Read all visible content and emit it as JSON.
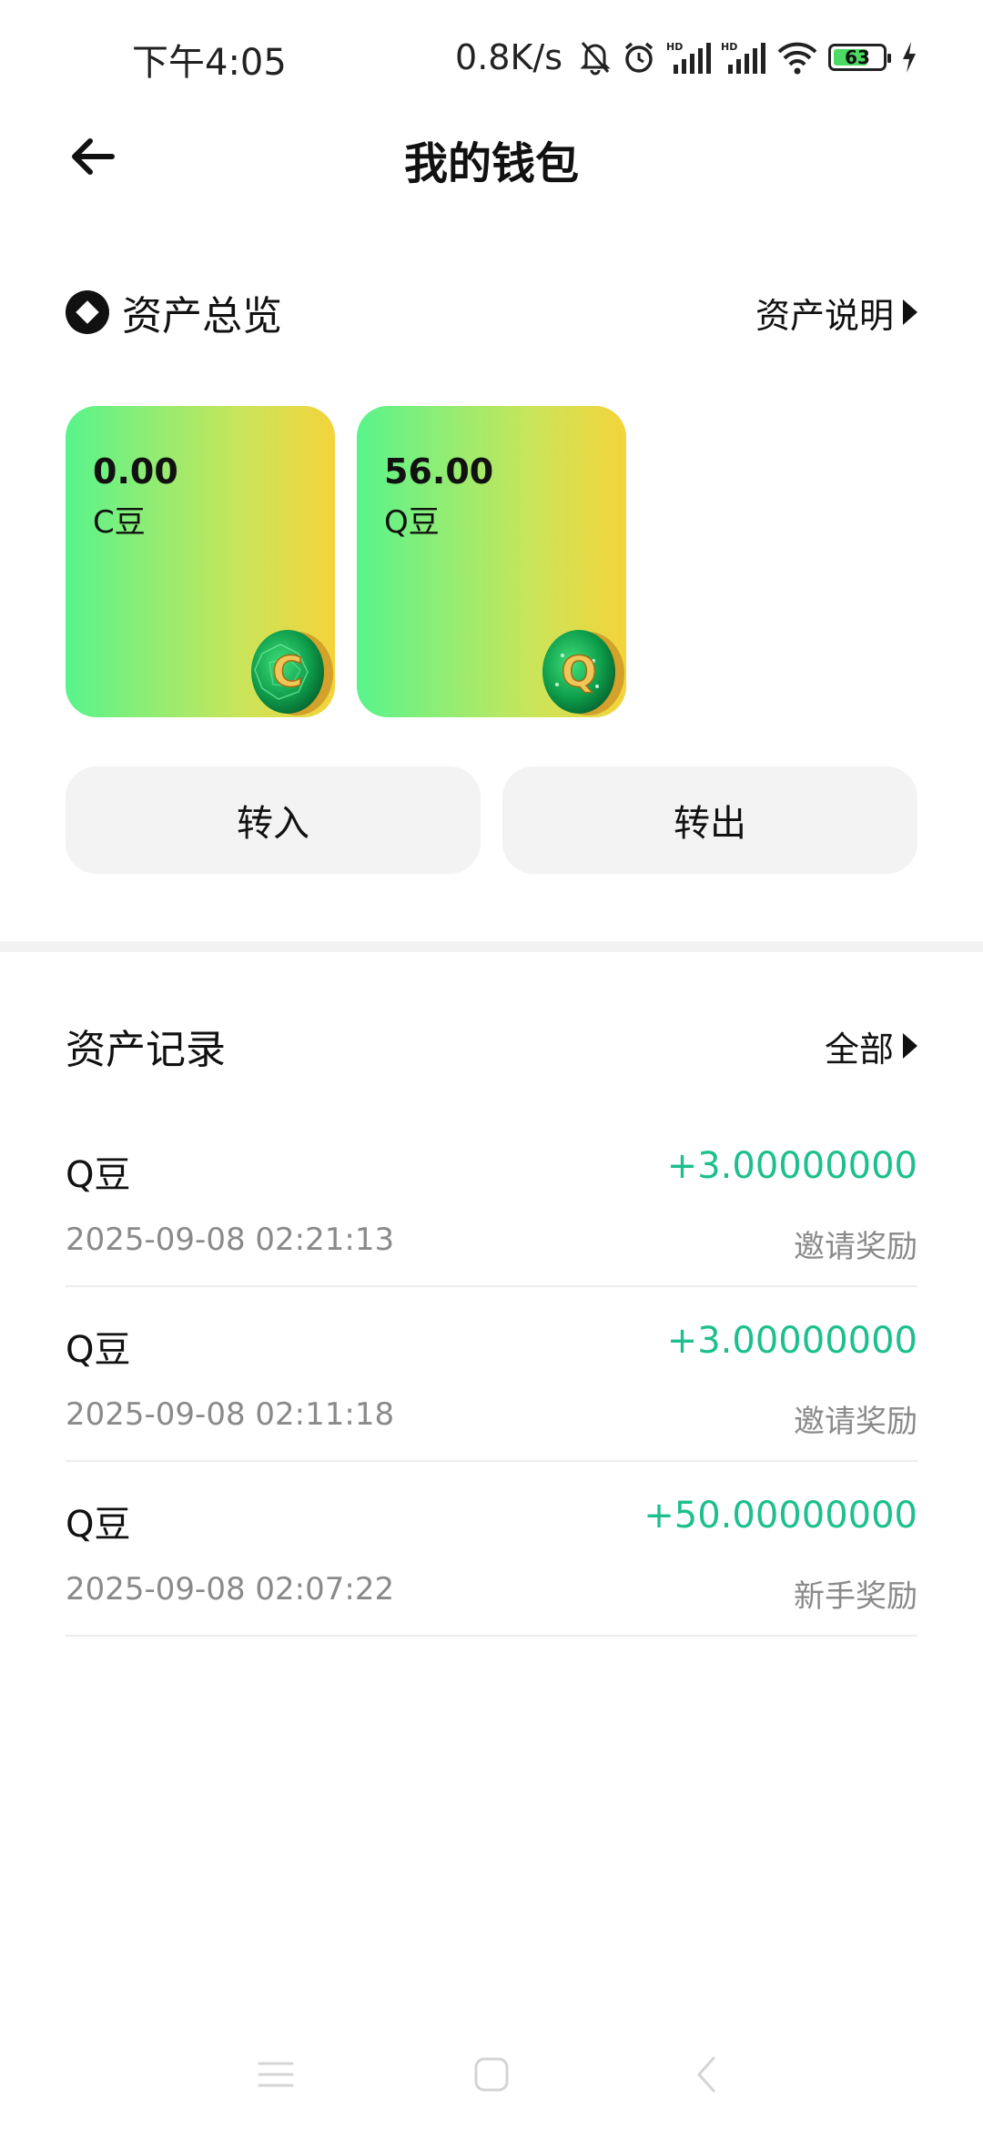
{
  "status_bar": {
    "time": "下午4:05",
    "net_speed": "0.8K/s",
    "icons": [
      "bell-muted-icon",
      "alarm-icon",
      "hd-signal-icon",
      "hd-signal-icon",
      "wifi-icon",
      "battery-icon",
      "charging-icon"
    ],
    "battery_level": "63"
  },
  "header": {
    "title": "我的钱包",
    "back_icon": "arrow-left-icon"
  },
  "overview": {
    "title": "资产总览",
    "explain_link": "资产说明",
    "cards": [
      {
        "amount": "0.00",
        "name": "C豆",
        "coin_letter": "C"
      },
      {
        "amount": "56.00",
        "name": "Q豆",
        "coin_letter": "Q"
      }
    ],
    "transfer_in": "转入",
    "transfer_out": "转出"
  },
  "records": {
    "title": "资产记录",
    "all_link": "全部",
    "items": [
      {
        "name": "Q豆",
        "amount": "+3.00000000",
        "date": "2025-09-08 02:21:13",
        "type": "邀请奖励"
      },
      {
        "name": "Q豆",
        "amount": "+3.00000000",
        "date": "2025-09-08 02:11:18",
        "type": "邀请奖励"
      },
      {
        "name": "Q豆",
        "amount": "+50.00000000",
        "date": "2025-09-08 02:07:22",
        "type": "新手奖励"
      }
    ]
  },
  "colors": {
    "accent_green": "#1dbf8e",
    "card_gradient_start": "#58f48c",
    "card_gradient_end": "#f4d33b"
  }
}
